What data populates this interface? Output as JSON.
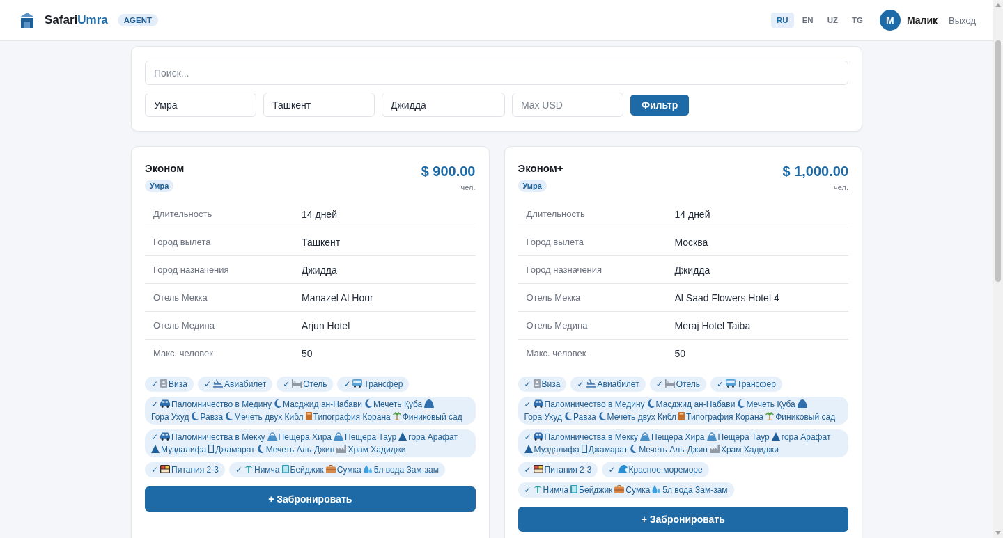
{
  "header": {
    "brand": {
      "first": "Safari",
      "second": "Umra"
    },
    "role_badge": "AGENT",
    "languages": [
      {
        "label": "RU",
        "selected": true
      },
      {
        "label": "EN",
        "selected": false
      },
      {
        "label": "UZ",
        "selected": false
      },
      {
        "label": "TG",
        "selected": false
      }
    ],
    "user": {
      "initial": "М",
      "name": "Малик"
    },
    "logout": "Выход"
  },
  "filters": {
    "search": {
      "placeholder": "Поиск..."
    },
    "tour_type": {
      "value": "Умра"
    },
    "departure": {
      "value": "Ташкент"
    },
    "destination": {
      "value": "Джидда"
    },
    "max_price": {
      "placeholder": "Max USD"
    },
    "button": "Фильтр"
  },
  "tours": [
    {
      "title": "Эконом",
      "type_badge": "Умра",
      "price": "$ 900.00",
      "price_unit": "чел.",
      "details": [
        {
          "label": "Длительность",
          "value": "14 дней"
        },
        {
          "label": "Город вылета",
          "value": "Ташкент"
        },
        {
          "label": "Город назначения",
          "value": "Джидда"
        },
        {
          "label": "Отель Мекка",
          "value": "Manazel Al Hour"
        },
        {
          "label": "Отель Медина",
          "value": "Arjun Hotel"
        },
        {
          "label": "Макс. человек",
          "value": "50"
        }
      ],
      "features": [
        {
          "mark": "✓",
          "items": [
            {
              "kind": "passport",
              "label": "Виза"
            }
          ]
        },
        {
          "mark": "✓",
          "items": [
            {
              "kind": "plane",
              "label": "Авиабилет"
            }
          ]
        },
        {
          "mark": "✓",
          "items": [
            {
              "kind": "bed",
              "label": "Отель"
            }
          ]
        },
        {
          "mark": "✓",
          "items": [
            {
              "kind": "bus",
              "label": "Трансфер"
            }
          ]
        },
        {
          "mark": "✓",
          "items": [
            {
              "kind": "car",
              "label": "Паломничество в Медину"
            },
            {
              "kind": "crescent",
              "label": "Масджид ан-Набави"
            },
            {
              "kind": "crescent",
              "label": "Мечеть Қуба"
            },
            {
              "kind": "hill",
              "label": "Гора"
            },
            {
              "kind": "text",
              "label": "Ухуд"
            },
            {
              "kind": "crescent",
              "label": "Равза"
            },
            {
              "kind": "crescent",
              "label": "Мечеть двух Кибл"
            },
            {
              "kind": "book",
              "label": "Типография Корана"
            },
            {
              "kind": "palm",
              "label": "Финиковый сад"
            }
          ]
        },
        {
          "mark": "✓",
          "items": [
            {
              "kind": "car",
              "label": "Паломничества в Мекку"
            },
            {
              "kind": "mound",
              "label": "Пещера Хира"
            },
            {
              "kind": "mound",
              "label": "Пещера Таур"
            },
            {
              "kind": "peak",
              "label": "гора Арафат"
            },
            {
              "kind": "peak",
              "label": "Муздалифа"
            },
            {
              "kind": "blank",
              "label": "Джамарат"
            },
            {
              "kind": "crescent",
              "label": "Мечеть Аль-Джин"
            },
            {
              "kind": "factory",
              "label": "Храм Хадиджи"
            }
          ]
        },
        {
          "mark": "✓",
          "items": [
            {
              "kind": "lunchbox",
              "label": "Питания 2-3"
            }
          ]
        },
        {
          "mark": "✓",
          "items": [
            {
              "kind": "tree",
              "label": "Нимча"
            },
            {
              "kind": "notebook",
              "label": "Бейджик"
            },
            {
              "kind": "briefcase",
              "label": "Сумка"
            },
            {
              "kind": "drops",
              "label": "5л вода Зам-зам"
            }
          ]
        }
      ],
      "book_button": "+ Забронировать"
    },
    {
      "title": "Эконом+",
      "type_badge": "Умра",
      "price": "$ 1,000.00",
      "price_unit": "чел.",
      "details": [
        {
          "label": "Длительность",
          "value": "14 дней"
        },
        {
          "label": "Город вылета",
          "value": "Москва"
        },
        {
          "label": "Город назначения",
          "value": "Джидда"
        },
        {
          "label": "Отель Мекка",
          "value": "Al Saad Flowers Hotel 4"
        },
        {
          "label": "Отель Медина",
          "value": "Meraj Hotel Taiba"
        },
        {
          "label": "Макс. человек",
          "value": "50"
        }
      ],
      "features": [
        {
          "mark": "✓",
          "items": [
            {
              "kind": "passport",
              "label": "Виза"
            }
          ]
        },
        {
          "mark": "✓",
          "items": [
            {
              "kind": "plane",
              "label": "Авиабилет"
            }
          ]
        },
        {
          "mark": "✓",
          "items": [
            {
              "kind": "bed",
              "label": "Отель"
            }
          ]
        },
        {
          "mark": "✓",
          "items": [
            {
              "kind": "bus",
              "label": "Трансфер"
            }
          ]
        },
        {
          "mark": "✓",
          "items": [
            {
              "kind": "car",
              "label": "Паломничество в Медину"
            },
            {
              "kind": "crescent",
              "label": "Масджид ан-Набави"
            },
            {
              "kind": "crescent",
              "label": "Мечеть Қуба"
            },
            {
              "kind": "hill",
              "label": "Гора"
            },
            {
              "kind": "text",
              "label": "Ухуд"
            },
            {
              "kind": "crescent",
              "label": "Равза"
            },
            {
              "kind": "crescent",
              "label": "Мечеть двух Кибл"
            },
            {
              "kind": "book",
              "label": "Типография Корана"
            },
            {
              "kind": "palm",
              "label": "Финиковый сад"
            }
          ]
        },
        {
          "mark": "✓",
          "items": [
            {
              "kind": "car",
              "label": "Паломничества в Мекку"
            },
            {
              "kind": "mound",
              "label": "Пещера Хира"
            },
            {
              "kind": "mound",
              "label": "Пещера Таур"
            },
            {
              "kind": "peak",
              "label": "гора Арафат"
            },
            {
              "kind": "peak",
              "label": "Муздалифа"
            },
            {
              "kind": "blank",
              "label": "Джамарат"
            },
            {
              "kind": "crescent",
              "label": "Мечеть Аль-Джин"
            },
            {
              "kind": "factory",
              "label": "Храм Хадиджи"
            }
          ]
        },
        {
          "mark": "✓",
          "items": [
            {
              "kind": "lunchbox",
              "label": "Питания 2-3"
            }
          ]
        },
        {
          "mark": "✓",
          "items": [
            {
              "kind": "wave",
              "label": "Красное мореморе"
            }
          ]
        },
        {
          "mark": "✓",
          "items": [
            {
              "kind": "tree",
              "label": "Нимча"
            },
            {
              "kind": "notebook",
              "label": "Бейджик"
            },
            {
              "kind": "briefcase",
              "label": "Сумка"
            },
            {
              "kind": "drops",
              "label": "5л вода Зам-зам"
            }
          ]
        }
      ],
      "book_button": "+ Забронировать"
    }
  ]
}
